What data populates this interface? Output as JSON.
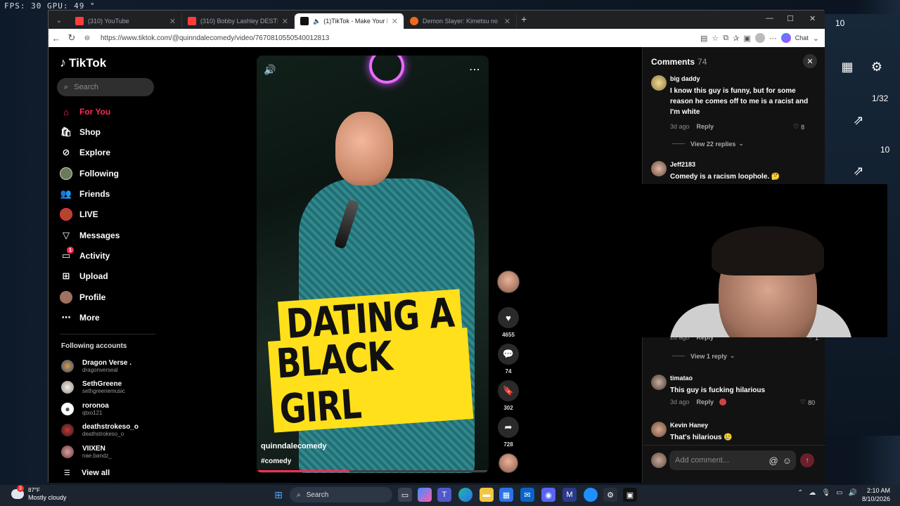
{
  "overlay": {
    "fps_text": "FPS:  30  GPU:  49 °"
  },
  "game": {
    "counter_top": "10",
    "counter_page": "1/32",
    "counter_small": "10"
  },
  "browser": {
    "tabs": [
      {
        "label": "(310) YouTube",
        "fav_color": "#ff3d3d"
      },
      {
        "label": "(310) Bobby Lashley DESTROYS Vi...",
        "fav_color": "#ff3d3d"
      },
      {
        "label": "(1)TikTok - Make Your Day",
        "fav_color": "#111111"
      },
      {
        "label": "Demon Slayer: Kimetsu no Yaiba In...",
        "fav_color": "#f06a1d"
      }
    ],
    "new_tab": "+",
    "url": "https://www.tiktok.com/@quinndalecomedy/video/7670810550540012813",
    "chat_label": "Chat"
  },
  "tiktok": {
    "logo": "TikTok",
    "search_placeholder": "Search",
    "nav": [
      {
        "label": "For You",
        "icon": "home-icon"
      },
      {
        "label": "Shop",
        "icon": "shop-icon"
      },
      {
        "label": "Explore",
        "icon": "compass-icon"
      },
      {
        "label": "Following",
        "icon": "following-avatar-icon"
      },
      {
        "label": "Friends",
        "icon": "friends-icon"
      },
      {
        "label": "LIVE",
        "icon": "live-icon"
      },
      {
        "label": "Messages",
        "icon": "messages-icon"
      },
      {
        "label": "Activity",
        "icon": "activity-icon"
      },
      {
        "label": "Upload",
        "icon": "upload-icon"
      },
      {
        "label": "Profile",
        "icon": "profile-icon"
      },
      {
        "label": "More",
        "icon": "more-icon"
      }
    ],
    "activity_badge": "1",
    "following_title": "Following accounts",
    "accounts": [
      {
        "name": "Dragon Verse .",
        "handle": "dragonverseal"
      },
      {
        "name": "SethGreene",
        "handle": "sethgreenemusic"
      },
      {
        "name": "roronoa",
        "handle": "qtxo121"
      },
      {
        "name": "deathstrokeso_o",
        "handle": "deathstrokeso_o"
      },
      {
        "name": "VIIXEN",
        "handle": "nae.bandz_"
      }
    ],
    "view_all": "View all"
  },
  "video": {
    "caption_line1": "DATING A",
    "caption_line2": "BLACK GIRL",
    "username": "quinndalecomedy",
    "tag": "#comedy",
    "progress": 0.4,
    "likes": "4655",
    "comments": "74",
    "saves": "302",
    "shares": "728"
  },
  "comments": {
    "title": "Comments",
    "count": "74",
    "items": [
      {
        "user": "big daddy",
        "text": "I know this guy is funny, but for some reason he comes off to me is a racist and I'm white",
        "time": "3d ago",
        "reply": "Reply",
        "likes": "8",
        "view_replies": "View 22 replies"
      },
      {
        "user": "Jeff2183",
        "text": "Comedy is a racism loophole. 🤔"
      },
      {
        "time": "2d ago",
        "reply": "Reply",
        "likes": "1",
        "view_replies": "View 1 reply"
      },
      {
        "user": "timatao",
        "text": "This guy is fucking hilarious",
        "time": "3d ago",
        "reply": "Reply",
        "likes": "80"
      },
      {
        "user": "Kevin Haney",
        "text": "That's hilarious 🥲"
      }
    ],
    "add_placeholder": "Add comment..."
  },
  "taskbar": {
    "temp": "87°F",
    "weather": "Mostly cloudy",
    "weather_badge": "3",
    "search_placeholder": "Search",
    "time": "2:10 AM",
    "date": "8/10/2026"
  }
}
